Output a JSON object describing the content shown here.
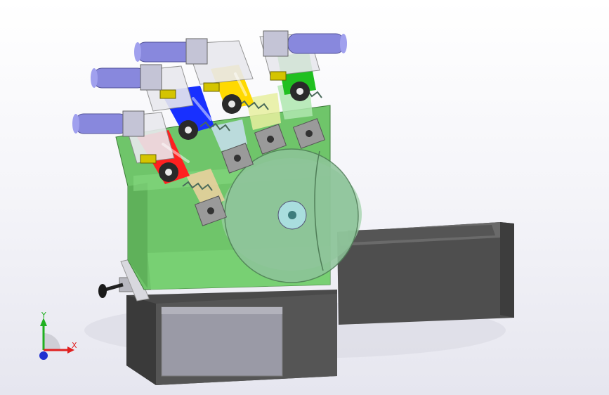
{
  "viewport": {
    "background_top": "#ffffff",
    "background_bottom": "#e6e6ef"
  },
  "triad": {
    "x_label": "X",
    "y_label": "Y",
    "x_color": "#e02020",
    "y_color": "#20b020",
    "z_color": "#2030d0"
  },
  "model": {
    "cylinder_color": "#8888dd",
    "frame_color": "#6fc56a",
    "base_color": "#4a4a4a",
    "chute_color": "#5a5a5a",
    "panel_color": "#9a9aa6",
    "rotor_color": "#8ec49a",
    "strips": [
      "#ff2020",
      "#1830ff",
      "#ffd900",
      "#20c020"
    ]
  }
}
